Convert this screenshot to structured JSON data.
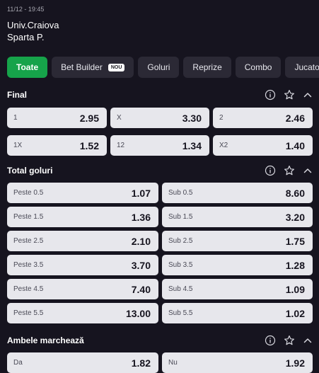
{
  "match": {
    "datetime": "11/12 - 19:45",
    "home": "Univ.Craiova",
    "away": "Sparta P."
  },
  "tabs": [
    {
      "label": "Toate",
      "active": true
    },
    {
      "label": "Bet Builder",
      "badge": "NOU"
    },
    {
      "label": "Goluri"
    },
    {
      "label": "Reprize"
    },
    {
      "label": "Combo"
    },
    {
      "label": "Jucatori"
    }
  ],
  "sections": {
    "final": {
      "title": "Final",
      "rows": [
        [
          {
            "label": "1",
            "odd": "2.95"
          },
          {
            "label": "X",
            "odd": "3.30"
          },
          {
            "label": "2",
            "odd": "2.46"
          }
        ],
        [
          {
            "label": "1X",
            "odd": "1.52"
          },
          {
            "label": "12",
            "odd": "1.34"
          },
          {
            "label": "X2",
            "odd": "1.40"
          }
        ]
      ]
    },
    "total": {
      "title": "Total goluri",
      "rows": [
        [
          {
            "label": "Peste 0.5",
            "odd": "1.07"
          },
          {
            "label": "Sub 0.5",
            "odd": "8.60"
          }
        ],
        [
          {
            "label": "Peste 1.5",
            "odd": "1.36"
          },
          {
            "label": "Sub 1.5",
            "odd": "3.20"
          }
        ],
        [
          {
            "label": "Peste 2.5",
            "odd": "2.10"
          },
          {
            "label": "Sub 2.5",
            "odd": "1.75"
          }
        ],
        [
          {
            "label": "Peste 3.5",
            "odd": "3.70"
          },
          {
            "label": "Sub 3.5",
            "odd": "1.28"
          }
        ],
        [
          {
            "label": "Peste 4.5",
            "odd": "7.40"
          },
          {
            "label": "Sub 4.5",
            "odd": "1.09"
          }
        ],
        [
          {
            "label": "Peste 5.5",
            "odd": "13.00"
          },
          {
            "label": "Sub 5.5",
            "odd": "1.02"
          }
        ]
      ]
    },
    "btts": {
      "title": "Ambele marchează",
      "rows": [
        [
          {
            "label": "Da",
            "odd": "1.82"
          },
          {
            "label": "Nu",
            "odd": "1.92"
          }
        ]
      ]
    }
  },
  "colors": {
    "background": "#16141f",
    "accent": "#16a34a",
    "tab": "#2b2935",
    "cell": "#e7e7ec"
  }
}
